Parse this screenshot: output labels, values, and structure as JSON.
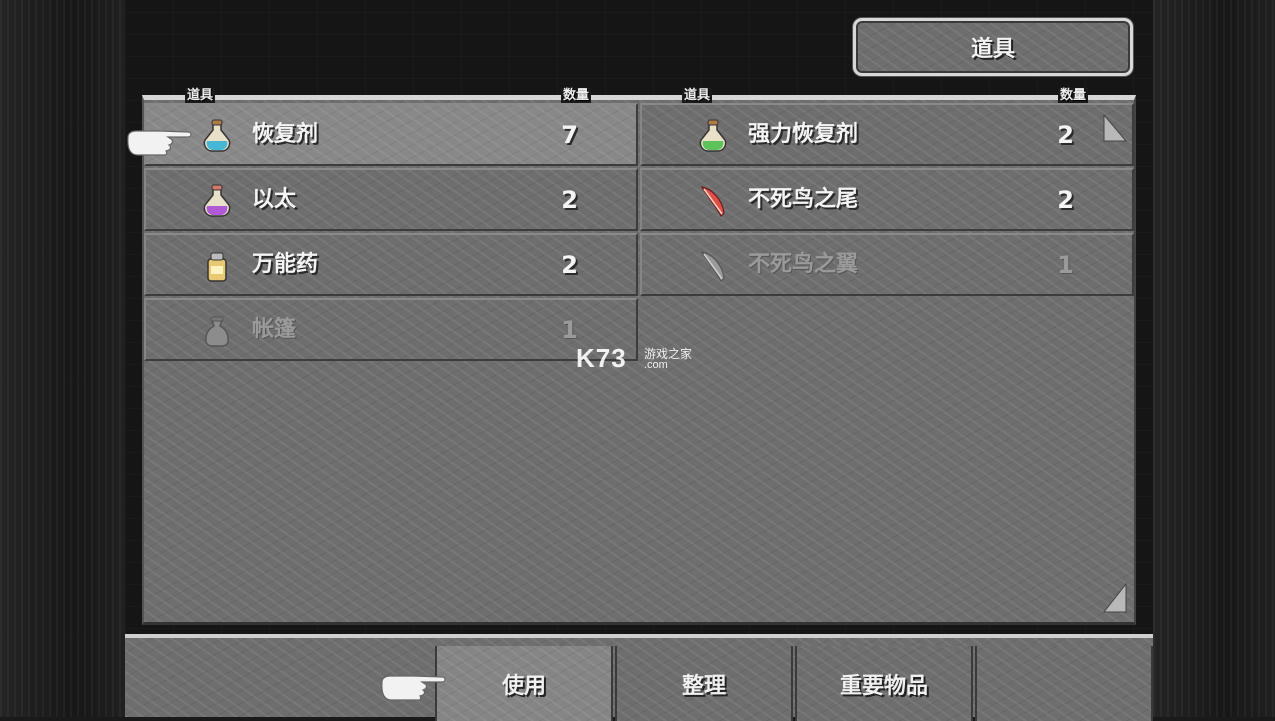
{
  "title": "道具",
  "columns": {
    "left": {
      "item_header": "道具",
      "qty_header": "数量"
    },
    "right": {
      "item_header": "道具",
      "qty_header": "数量"
    }
  },
  "items": [
    {
      "name": "恢复剂",
      "qty": "7",
      "icon": "blue-potion-icon",
      "color": "#46b8d6",
      "enabled": true
    },
    {
      "name": "强力恢复剂",
      "qty": "2",
      "icon": "green-potion-icon",
      "color": "#5cc25a",
      "enabled": true
    },
    {
      "name": "以太",
      "qty": "2",
      "icon": "purple-potion-icon",
      "color": "#b05ad6",
      "enabled": true
    },
    {
      "name": "不死鸟之尾",
      "qty": "2",
      "icon": "red-feather-icon",
      "color": "#e0504a",
      "enabled": true
    },
    {
      "name": "万能药",
      "qty": "2",
      "icon": "remedy-bottle-icon",
      "color": "#e8c870",
      "enabled": true
    },
    {
      "name": "不死鸟之翼",
      "qty": "1",
      "icon": "gray-feather-icon",
      "color": "#8c8c8c",
      "enabled": false
    },
    {
      "name": "帐篷",
      "qty": "1",
      "icon": "tent-bag-icon",
      "color": "#8c8c8c",
      "enabled": false
    }
  ],
  "selected_item": "恢复剂",
  "commands": [
    {
      "label": "使用",
      "active": true
    },
    {
      "label": "整理",
      "active": false
    },
    {
      "label": "重要物品",
      "active": false
    }
  ],
  "watermark": {
    "logo": "K73",
    "text": "游戏之家",
    "domain": ".com"
  }
}
